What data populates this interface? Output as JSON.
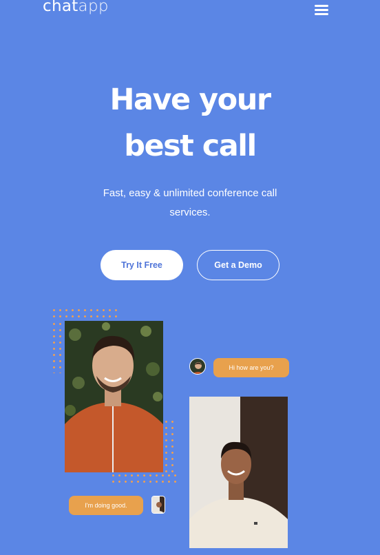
{
  "header": {
    "logo_part1": "chat",
    "logo_part2": "app",
    "menu_icon": "hamburger-menu-icon"
  },
  "hero": {
    "title_line1": "Have your",
    "title_line2": "best call",
    "subtitle": "Fast, easy & unlimited conference call services.",
    "primary_button": "Try It Free",
    "secondary_button": "Get a Demo"
  },
  "chat": {
    "incoming_message": "Hi how are you?",
    "reply_message": "I'm doing good."
  },
  "colors": {
    "background": "#5b86e5",
    "accent": "#e8a14d",
    "button_text": "#4f74d8"
  }
}
